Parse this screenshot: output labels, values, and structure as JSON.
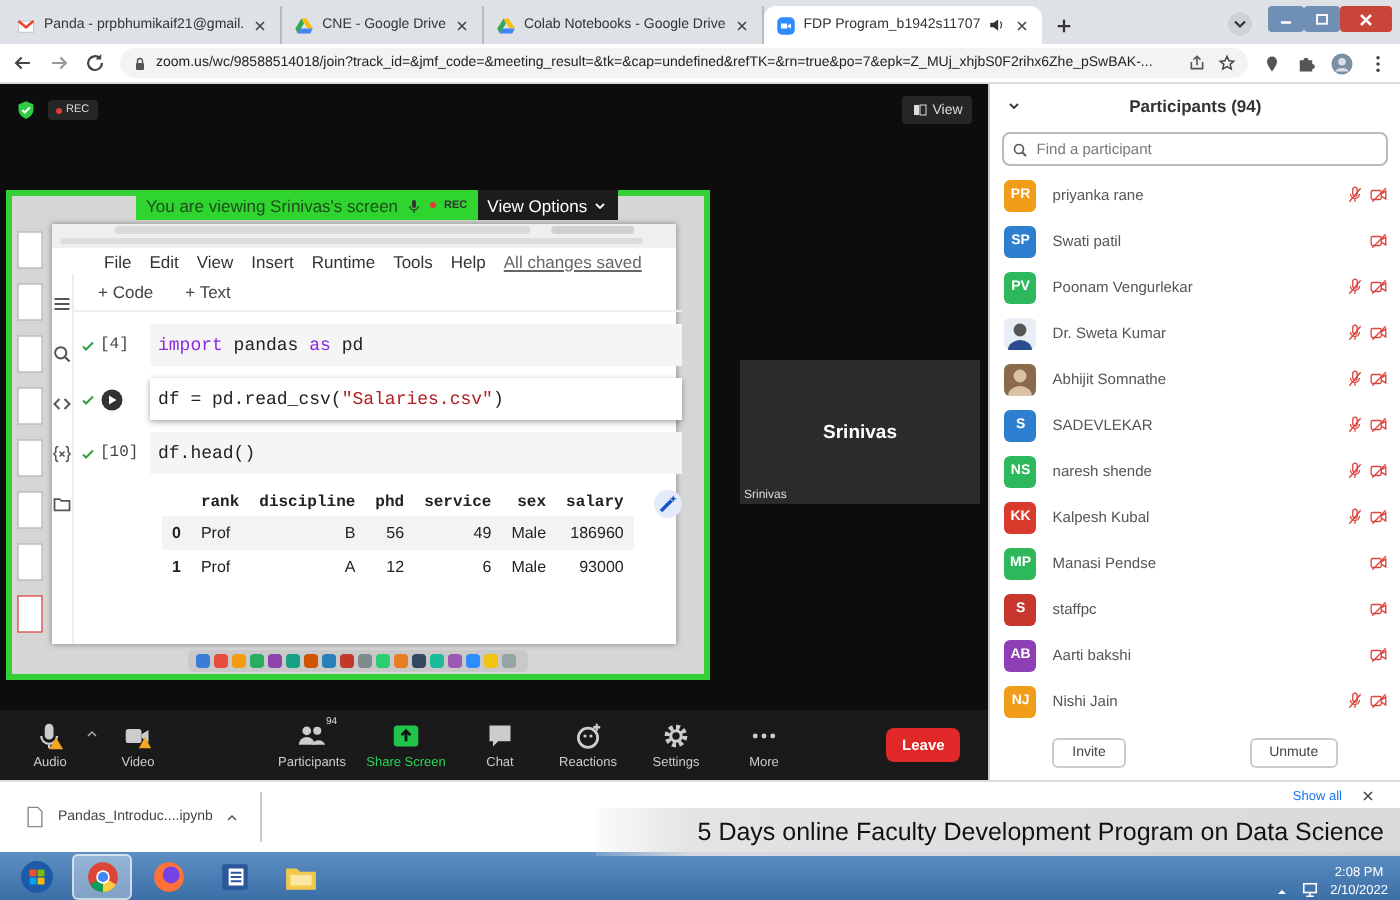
{
  "browser": {
    "tabs": [
      {
        "kind": "mail",
        "label": "Panda - prpbhumikaif21@gmail.",
        "selected": false,
        "audio": false
      },
      {
        "kind": "drive",
        "label": "CNE - Google Drive",
        "selected": false,
        "audio": false
      },
      {
        "kind": "drive",
        "label": "Colab Notebooks - Google Drive",
        "selected": false,
        "audio": false
      },
      {
        "kind": "meeting",
        "label": "FDP Program_b1942s11707",
        "selected": true,
        "audio": true
      }
    ],
    "url": "zoom.us/wc/98588514018/join?track_id=&jmf_code=&meeting_result=&tk=&cap=undefined&refTK=&rn=true&po=7&epk=Z_MUj_xhjbS0F2rihx6Zhe_pSwBAK-..."
  },
  "meeting": {
    "rec_badge": "REC",
    "view_button": "View",
    "share_banner": {
      "text": "You are viewing Srinivas's screen",
      "rec": "REC",
      "options": "View Options"
    },
    "shared_screen": {
      "menu": [
        "File",
        "Edit",
        "View",
        "Insert",
        "Runtime",
        "Tools",
        "Help"
      ],
      "save_status": "All changes saved",
      "add_buttons": [
        "+ Code",
        "+ Text"
      ],
      "cells": [
        {
          "kind": "plain",
          "count": "[4]",
          "done": true,
          "tokens": [
            {
              "kind": "keyword",
              "text": "import"
            },
            {
              "kind": "plain",
              "text": " pandas "
            },
            {
              "kind": "keyword",
              "text": "as"
            },
            {
              "kind": "plain",
              "text": " pd"
            }
          ]
        },
        {
          "kind": "active",
          "done": true,
          "tokens": [
            {
              "kind": "plain",
              "text": "df = pd.read_csv("
            },
            {
              "kind": "string",
              "text": "\"Salaries.csv\""
            },
            {
              "kind": "plain",
              "text": ")"
            }
          ]
        },
        {
          "kind": "plain",
          "count": "[10]",
          "done": true,
          "tokens": [
            {
              "kind": "plain",
              "text": "df.head()"
            }
          ]
        }
      ],
      "table": {
        "columns": [
          "rank",
          "discipline",
          "phd",
          "service",
          "sex",
          "salary"
        ],
        "rows": [
          {
            "index": "0",
            "values": [
              "Prof",
              "B",
              "56",
              "49",
              "Male",
              "186960"
            ]
          },
          {
            "index": "1",
            "values": [
              "Prof",
              "A",
              "12",
              "6",
              "Male",
              "93000"
            ]
          }
        ]
      }
    },
    "video_tile": {
      "name": "Srinivas",
      "label": "Srinivas"
    },
    "toolbar": {
      "items": [
        {
          "kind": "audio",
          "label": "Audio"
        },
        {
          "kind": "video",
          "label": "Video"
        },
        {
          "kind": "participants",
          "label": "Participants",
          "badge": "94"
        },
        {
          "kind": "share",
          "label": "Share Screen"
        },
        {
          "kind": "chat",
          "label": "Chat"
        },
        {
          "kind": "reactions",
          "label": "Reactions"
        },
        {
          "kind": "settings",
          "label": "Settings"
        },
        {
          "kind": "more",
          "label": "More"
        }
      ],
      "leave": "Leave"
    }
  },
  "participants": {
    "title": "Participants (94)",
    "search": {
      "placeholder": "Find a participant"
    },
    "items": [
      {
        "kind": "initials",
        "name": "priyanka rane",
        "initials": "PR",
        "color": "#f29d1a",
        "mic_muted": true,
        "video_off": true
      },
      {
        "kind": "initials",
        "name": "Swati patil",
        "initials": "SP",
        "color": "#2f7fd0",
        "mic_muted": false,
        "video_off": true
      },
      {
        "kind": "initials",
        "name": "Poonam Vengurlekar",
        "initials": "PV",
        "color": "#2eb85c",
        "mic_muted": true,
        "video_off": true
      },
      {
        "kind": "photo",
        "name": "Dr. Sweta Kumar",
        "mic_muted": true,
        "video_off": true
      },
      {
        "kind": "photo",
        "name": "Abhijit Somnathe",
        "mic_muted": true,
        "video_off": true
      },
      {
        "kind": "initials",
        "name": "SADEVLEKAR",
        "initials": "S",
        "color": "#2f7fd0",
        "mic_muted": true,
        "video_off": true
      },
      {
        "kind": "initials",
        "name": "naresh shende",
        "initials": "NS",
        "color": "#2eb85c",
        "mic_muted": true,
        "video_off": true
      },
      {
        "kind": "initials",
        "name": "Kalpesh Kubal",
        "initials": "KK",
        "color": "#d93a2b",
        "mic_muted": true,
        "video_off": true
      },
      {
        "kind": "initials",
        "name": "Manasi Pendse",
        "initials": "MP",
        "color": "#2eb85c",
        "mic_muted": false,
        "video_off": true
      },
      {
        "kind": "initials",
        "name": "staffpc",
        "initials": "S",
        "color": "#c8372d",
        "mic_muted": false,
        "video_off": true
      },
      {
        "kind": "initials",
        "name": "Aarti bakshi",
        "initials": "AB",
        "color": "#8e3fb5",
        "mic_muted": false,
        "video_off": true
      },
      {
        "kind": "initials",
        "name": "Nishi Jain",
        "initials": "NJ",
        "color": "#f29d1a",
        "mic_muted": true,
        "video_off": true
      }
    ],
    "buttons": [
      "Invite",
      "Unmute"
    ]
  },
  "downloads": {
    "file": "Pandas_Introduc....ipynb",
    "show_all": "Show all"
  },
  "caption": "5 Days online Faculty Development Program on Data Science",
  "taskbar": {
    "apps": [
      {
        "kind": "start",
        "selected": false
      },
      {
        "kind": "chrome",
        "selected": true
      },
      {
        "kind": "firefox",
        "selected": false
      },
      {
        "kind": "word",
        "selected": false
      },
      {
        "kind": "explorer",
        "selected": false
      }
    ],
    "time": "2:08 PM",
    "date": "2/10/2022"
  }
}
